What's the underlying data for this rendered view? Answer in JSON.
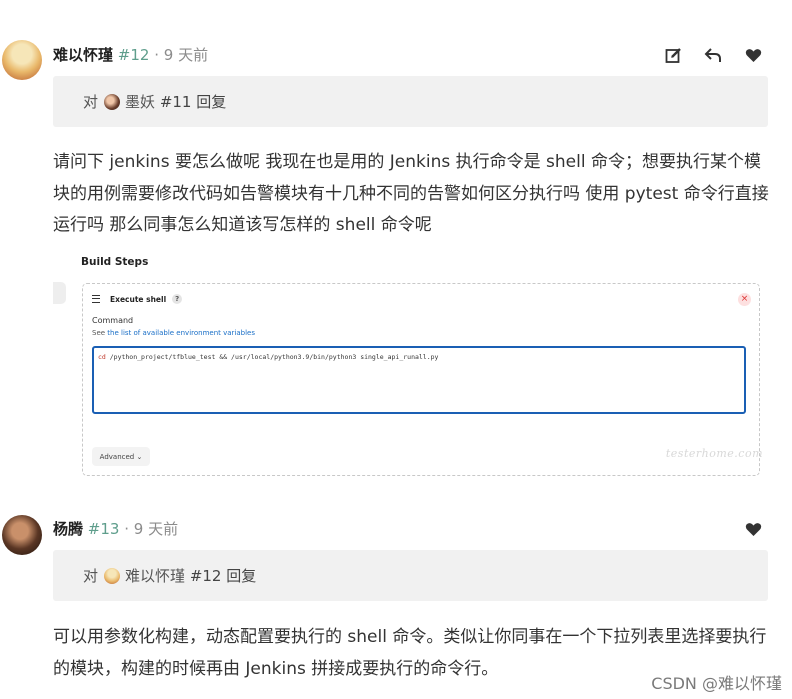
{
  "posts": [
    {
      "user": "难以怀瑾",
      "floor": "#12",
      "time": "· 9 天前",
      "reply_prefix": "对",
      "reply_to": "墨妖",
      "reply_ref": "#11 回复",
      "content": "请问下 jenkins 要怎么做呢 我现在也是用的 Jenkins 执行命令是 shell 命令；想要执行某个模块的用例需要修改代码如告警模块有十几种不同的告警如何区分执行吗 使用 pytest 命令行直接运行吗 那么同事怎么知道该写怎样的 shell 命令呢",
      "actions": [
        "edit-icon",
        "reply-icon",
        "heart-icon"
      ]
    },
    {
      "user": "杨腾",
      "floor": "#13",
      "time": "· 9 天前",
      "reply_prefix": "对",
      "reply_to": "难以怀瑾",
      "reply_ref": "#12 回复",
      "content": "可以用参数化构建，动态配置要执行的 shell 命令。类似让你同事在一个下拉列表里选择要执行的模块，构建的时候再由 Jenkins 拼接成要执行的命令行。",
      "actions": [
        "heart-icon"
      ]
    }
  ],
  "screenshot": {
    "title": "Build Steps",
    "step_name": "Execute shell",
    "help": "?",
    "close": "×",
    "command_label": "Command",
    "see_prefix": "See",
    "see_link": "the list of available environment variables",
    "code_cd": "cd",
    "code_rest": " /python_project/tfblue_test  && /usr/local/python3.9/bin/python3 single_api_runall.py",
    "advanced": "Advanced ⌄",
    "watermark": "testerhome.com"
  },
  "footer_watermark": "CSDN @难以怀瑾",
  "colors": {
    "floor": "#5f9e8c",
    "link": "#1a6fc7",
    "code_border": "#1a5fb4"
  }
}
